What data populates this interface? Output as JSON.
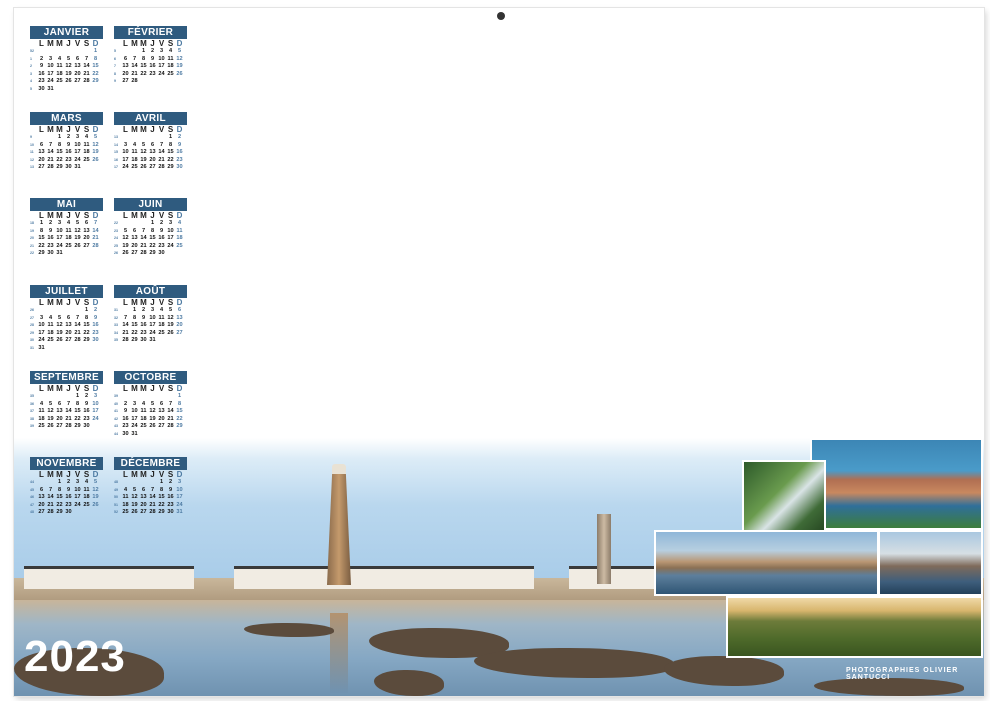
{
  "year": "2023",
  "weekday_header": [
    "L",
    "M",
    "M",
    "J",
    "V",
    "S",
    "D"
  ],
  "months": [
    {
      "name": "JANVIER",
      "offset": 6,
      "days": 31,
      "weeks": [
        "52",
        "1",
        "2",
        "3",
        "4",
        "5"
      ]
    },
    {
      "name": "FÉVRIER",
      "offset": 2,
      "days": 28,
      "weeks": [
        "5",
        "6",
        "7",
        "8",
        "9"
      ]
    },
    {
      "name": "MARS",
      "offset": 2,
      "days": 31,
      "weeks": [
        "9",
        "10",
        "11",
        "12",
        "13"
      ]
    },
    {
      "name": "AVRIL",
      "offset": 5,
      "days": 30,
      "weeks": [
        "13",
        "14",
        "15",
        "16",
        "17"
      ]
    },
    {
      "name": "MAI",
      "offset": 0,
      "days": 31,
      "weeks": [
        "18",
        "19",
        "20",
        "21",
        "22"
      ]
    },
    {
      "name": "JUIN",
      "offset": 3,
      "days": 30,
      "weeks": [
        "22",
        "23",
        "24",
        "25",
        "26"
      ]
    },
    {
      "name": "JUILLET",
      "offset": 5,
      "days": 31,
      "weeks": [
        "26",
        "27",
        "28",
        "29",
        "30",
        "31"
      ]
    },
    {
      "name": "AOÛT",
      "offset": 1,
      "days": 31,
      "weeks": [
        "31",
        "32",
        "33",
        "34",
        "35"
      ]
    },
    {
      "name": "SEPTEMBRE",
      "offset": 4,
      "days": 30,
      "weeks": [
        "35",
        "36",
        "37",
        "38",
        "39"
      ]
    },
    {
      "name": "OCTOBRE",
      "offset": 6,
      "days": 31,
      "weeks": [
        "39",
        "40",
        "41",
        "42",
        "43",
        "44"
      ]
    },
    {
      "name": "NOVEMBRE",
      "offset": 2,
      "days": 30,
      "weeks": [
        "44",
        "45",
        "46",
        "47",
        "48"
      ]
    },
    {
      "name": "DÉCEMBRE",
      "offset": 4,
      "days": 31,
      "weeks": [
        "48",
        "49",
        "50",
        "51",
        "52"
      ]
    }
  ],
  "credit": "PHOTOGRAPHIES OLIVIER SANTUCCI",
  "colors": {
    "month_header": "#2f5b7f",
    "sunday": "#4e7ba3"
  }
}
